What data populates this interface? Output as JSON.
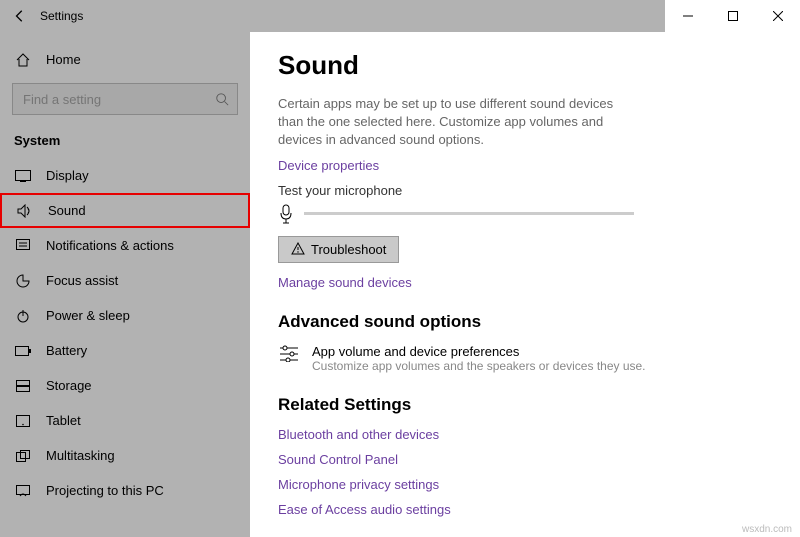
{
  "window": {
    "title": "Settings"
  },
  "sidebar": {
    "home": "Home",
    "searchPlaceholder": "Find a setting",
    "category": "System",
    "items": [
      {
        "label": "Display"
      },
      {
        "label": "Sound"
      },
      {
        "label": "Notifications & actions"
      },
      {
        "label": "Focus assist"
      },
      {
        "label": "Power & sleep"
      },
      {
        "label": "Battery"
      },
      {
        "label": "Storage"
      },
      {
        "label": "Tablet"
      },
      {
        "label": "Multitasking"
      },
      {
        "label": "Projecting to this PC"
      }
    ]
  },
  "main": {
    "heading": "Sound",
    "description": "Certain apps may be set up to use different sound devices than the one selected here. Customize app volumes and devices in advanced sound options.",
    "deviceProps": "Device properties",
    "testMic": "Test your microphone",
    "troubleshoot": "Troubleshoot",
    "manageDevices": "Manage sound devices",
    "advancedHeading": "Advanced sound options",
    "prefTitle": "App volume and device preferences",
    "prefSub": "Customize app volumes and the speakers or devices they use.",
    "relatedHeading": "Related Settings",
    "relatedLinks": [
      "Bluetooth and other devices",
      "Sound Control Panel",
      "Microphone privacy settings",
      "Ease of Access audio settings"
    ]
  },
  "watermark": "wsxdn.com"
}
